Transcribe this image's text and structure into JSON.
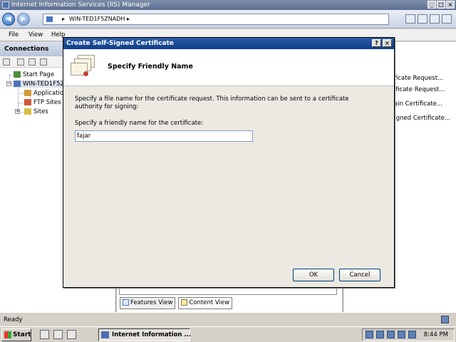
{
  "window": {
    "title": "Internet Information Services (IIS) Manager",
    "controls": [
      "_",
      "□",
      "×"
    ]
  },
  "nav": {
    "back_glyph": "◀",
    "forward_glyph": "▶",
    "address_separator": "▸",
    "address": "WIN-TED1F5ZNADH",
    "address_suffix": "▸"
  },
  "menu": {
    "file": "File",
    "view": "View",
    "help": "Help"
  },
  "connections": {
    "title": "Connections",
    "tree": {
      "start_page": "Start Page",
      "server": "WIN-TED1F5Z",
      "application_pools": "Applicatio",
      "ftp_sites": "FTP Sites",
      "sites": "Sites"
    }
  },
  "center": {
    "features_view": "Features View",
    "content_view": "Content View"
  },
  "actions": {
    "items": [
      "ficate Request...",
      "rtificate Request...",
      "ain Certificate...",
      "Signed Certificate..."
    ]
  },
  "status": {
    "text": "Ready"
  },
  "taskbar": {
    "start": "Start",
    "task": "Internet Information ...",
    "clock": "8:44 PM"
  },
  "dialog": {
    "title": "Create Self-Signed Certificate",
    "help_glyph": "?",
    "close_glyph": "×",
    "heading": "Specify Friendly Name",
    "description": "Specify a file name for the certificate request.  This information can be sent to a certificate authority for signing:",
    "label": "Specify a friendly name for the certificate:",
    "friendly_name": "fajar",
    "ok": "OK",
    "cancel": "Cancel"
  },
  "colors": {
    "dialog_title": "#0e3d88",
    "panel_header": "#b6c4da",
    "window_title": "#5c6f93"
  }
}
